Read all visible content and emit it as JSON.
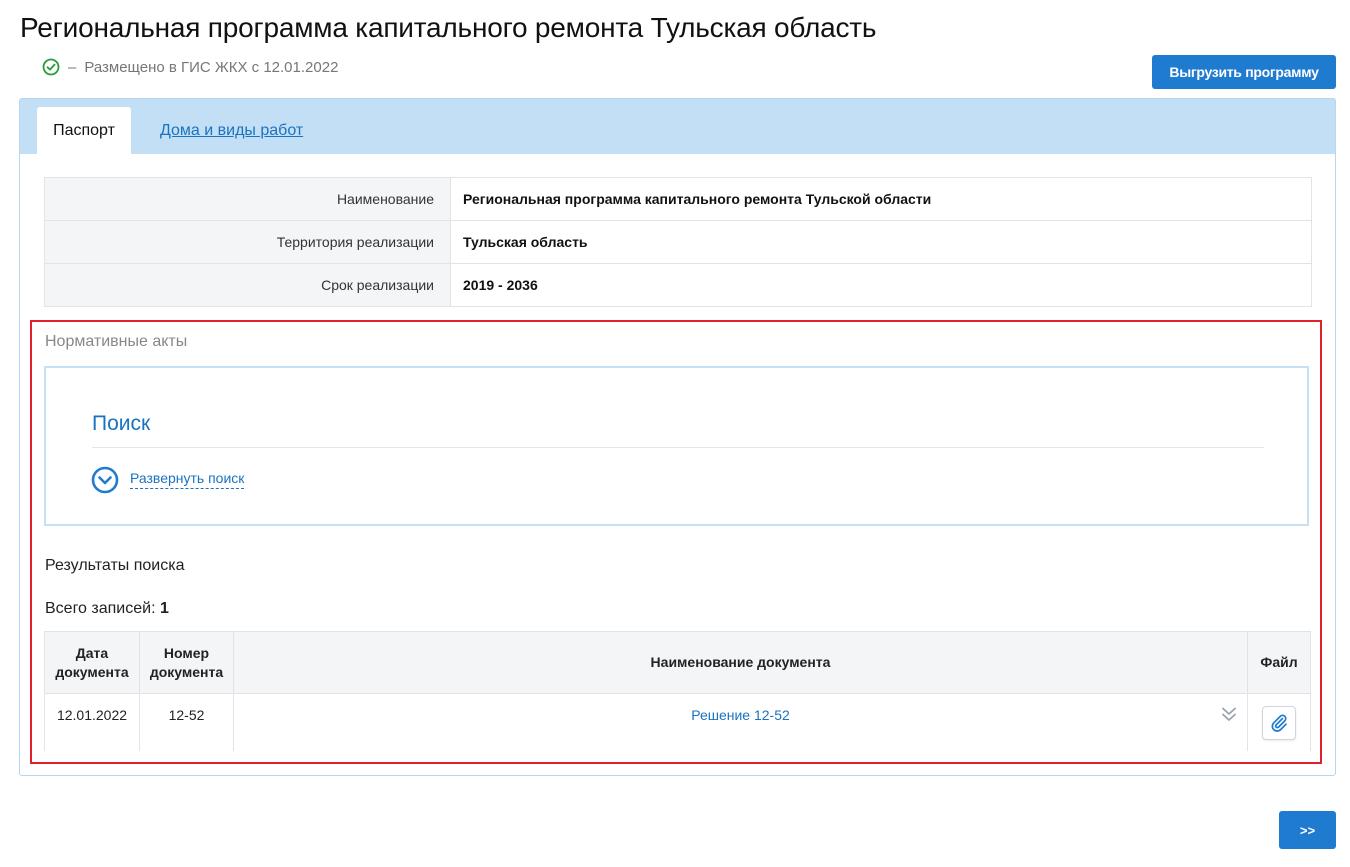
{
  "header": {
    "title": "Региональная программа капитального ремонта Тульская область",
    "status_dash": "–",
    "status_text": "Размещено в ГИС ЖКХ с 12.01.2022",
    "export_button": "Выгрузить программу"
  },
  "tabs": [
    {
      "label": "Паспорт",
      "active": true
    },
    {
      "label": "Дома и виды работ",
      "active": false
    }
  ],
  "passport": [
    {
      "label": "Наименование",
      "value": "Региональная программа капитального ремонта Тульской области"
    },
    {
      "label": "Территория реализации",
      "value": "Тульская область"
    },
    {
      "label": "Срок реализации",
      "value": "2019 - 2036"
    }
  ],
  "normative": {
    "title": "Нормативные акты",
    "search_title": "Поиск",
    "expand_label": "Развернуть поиск",
    "results_heading": "Результаты поиска",
    "total_label": "Всего записей:",
    "total_count": "1",
    "columns": [
      "Дата документа",
      "Номер документа",
      "Наименование документа",
      "Файл"
    ],
    "rows": [
      {
        "date": "12.01.2022",
        "number": "12-52",
        "name": "Решение 12-52"
      }
    ]
  },
  "footer": {
    "next_button": ">>"
  },
  "icons": {
    "status": "check-circle-icon",
    "expand": "chevron-down-circle-icon",
    "row_expand": "double-chevron-down-icon",
    "file": "paperclip-icon"
  },
  "colors": {
    "accent": "#1f7bd0",
    "link": "#1a73c0",
    "tabs_bar": "#c3dff5",
    "status_ok": "#2a9d3a",
    "highlight": "#e0202a"
  }
}
